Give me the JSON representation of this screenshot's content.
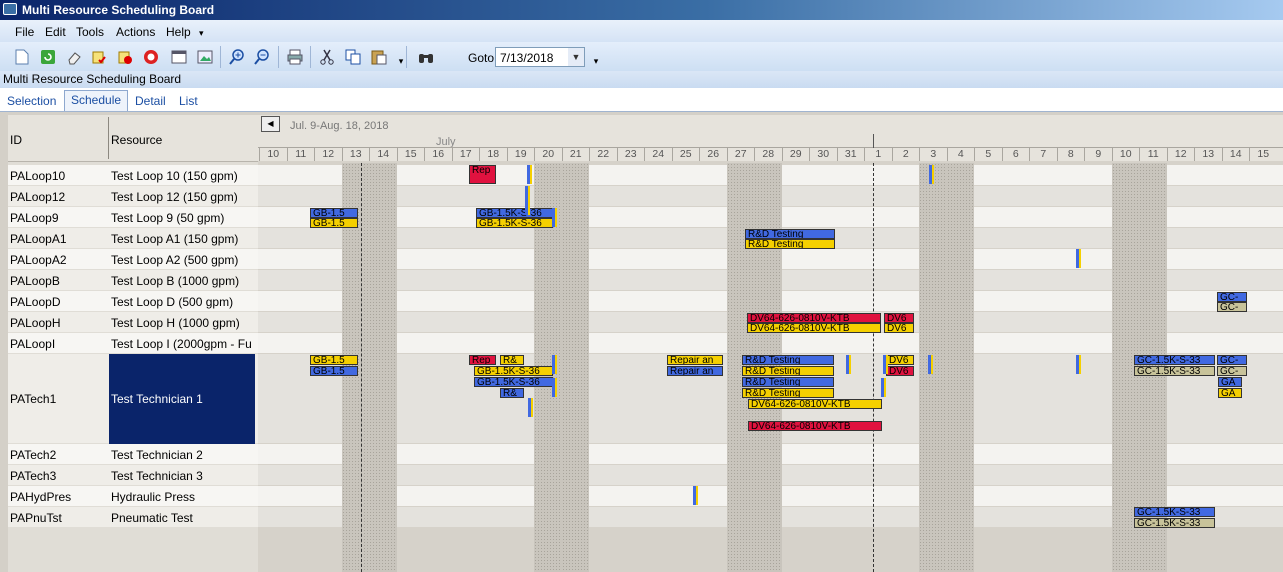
{
  "window": {
    "title": "Multi Resource  Scheduling Board"
  },
  "menu": [
    "File",
    "Edit",
    "Tools",
    "Actions",
    "Help"
  ],
  "toolbar": {
    "goto_label": "Goto",
    "goto_value": "7/13/2018"
  },
  "form_title": "Multi Resource Scheduling Board",
  "tabs": [
    "Selection",
    "Schedule",
    "Detail",
    "List"
  ],
  "grid": {
    "col_id": "ID",
    "col_resource": "Resource",
    "range_label": "Jul. 9-Aug. 18, 2018",
    "month_label": "July",
    "days": [
      "10",
      "11",
      "12",
      "13",
      "14",
      "15",
      "16",
      "17",
      "18",
      "19",
      "20",
      "21",
      "22",
      "23",
      "24",
      "25",
      "26",
      "27",
      "28",
      "29",
      "30",
      "31",
      "1",
      "2",
      "3",
      "4",
      "5",
      "6",
      "7",
      "8",
      "9",
      "10",
      "11",
      "12",
      "13",
      "14",
      "15"
    ],
    "rows": [
      {
        "id": "PALoop10",
        "resource": "Test Loop 10 (150 gpm)"
      },
      {
        "id": "PALoop12",
        "resource": "Test Loop 12 (150 gpm)"
      },
      {
        "id": "PALoop9",
        "resource": "Test Loop 9 (50 gpm)"
      },
      {
        "id": "PALoopA1",
        "resource": "Test Loop A1 (150 gpm)"
      },
      {
        "id": "PALoopA2",
        "resource": "Test Loop A2 (500 gpm)"
      },
      {
        "id": "PALoopB",
        "resource": "Test Loop B (1000 gpm)"
      },
      {
        "id": "PALoopD",
        "resource": "Test Loop D (500 gpm)"
      },
      {
        "id": "PALoopH",
        "resource": "Test Loop H (1000 gpm)"
      },
      {
        "id": "PALoopI",
        "resource": "Test Loop I (2000gpm - Fu"
      },
      {
        "id": "PATech1",
        "resource": "Test Technician 1"
      },
      {
        "id": "PATech2",
        "resource": "Test Technician 2"
      },
      {
        "id": "PATech3",
        "resource": "Test Technician 3"
      },
      {
        "id": "PAHydPres",
        "resource": "Hydraulic Press"
      },
      {
        "id": "PAPnuTst",
        "resource": "Pneumatic Test"
      }
    ]
  },
  "bars": [
    {
      "text": "Rep",
      "color": "red"
    },
    {
      "text": "GB-1.5",
      "color": "blue"
    },
    {
      "text": "GB-1.5",
      "color": "yellow"
    },
    {
      "text": "GB-1.5K-S-36",
      "color": "blue"
    },
    {
      "text": "GB-1.5K-S-36",
      "color": "yellow"
    },
    {
      "text": "R&D Testing",
      "color": "blue"
    },
    {
      "text": "R&D Testing",
      "color": "yellow"
    },
    {
      "text": "GC-",
      "color": "blue"
    },
    {
      "text": "GC-",
      "color": "olive"
    },
    {
      "text": "DV64-626-0810V-KTB",
      "color": "red"
    },
    {
      "text": "DV64-626-0810V-KTB",
      "color": "yellow"
    },
    {
      "text": "DV6",
      "color": "red"
    },
    {
      "text": "DV6",
      "color": "yellow"
    },
    {
      "text": "GB-1.5",
      "color": "yellow"
    },
    {
      "text": "GB-1.5",
      "color": "blue"
    },
    {
      "text": "Rep",
      "color": "red"
    },
    {
      "text": "R&",
      "color": "yellow"
    },
    {
      "text": "GB-1.5K-S-36",
      "color": "yellow"
    },
    {
      "text": "GB-1.5K-S-36",
      "color": "blue"
    },
    {
      "text": "R&",
      "color": "blue"
    },
    {
      "text": "Repair an",
      "color": "yellow"
    },
    {
      "text": "Repair an",
      "color": "blue"
    },
    {
      "text": "R&D Testing",
      "color": "blue"
    },
    {
      "text": "R&D Testing",
      "color": "yellow"
    },
    {
      "text": "R&D Testing",
      "color": "blue"
    },
    {
      "text": "R&D Testing",
      "color": "yellow"
    },
    {
      "text": "DV64-626-0810V-KTB",
      "color": "yellow"
    },
    {
      "text": "DV64-626-0810V-KTB",
      "color": "red"
    },
    {
      "text": "DV6",
      "color": "yellow"
    },
    {
      "text": "DV6",
      "color": "red"
    },
    {
      "text": "GC-1.5K-S-33",
      "color": "blue"
    },
    {
      "text": "GC-1.5K-S-33",
      "color": "olive"
    },
    {
      "text": "GC-",
      "color": "blue"
    },
    {
      "text": "GC-",
      "color": "olive"
    },
    {
      "text": "GA",
      "color": "blue"
    },
    {
      "text": "GA",
      "color": "yellow"
    },
    {
      "text": "GC-1.5K-S-33",
      "color": "blue"
    },
    {
      "text": "GC-1.5K-S-33",
      "color": "olive"
    }
  ]
}
